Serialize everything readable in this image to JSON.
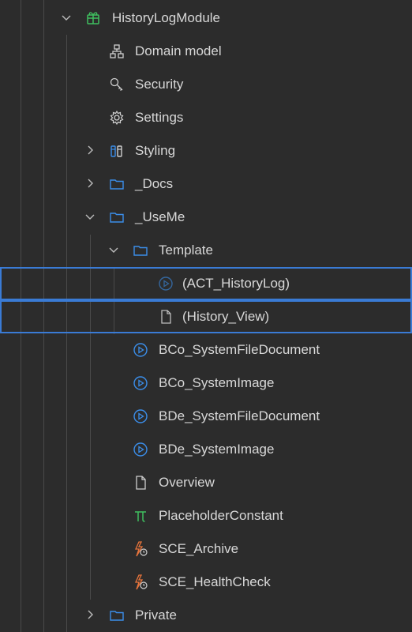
{
  "tree": {
    "items": [
      {
        "label": "HistoryLogModule",
        "icon": "module-icon"
      },
      {
        "label": "Domain model",
        "icon": "domain-model-icon"
      },
      {
        "label": "Security",
        "icon": "key-icon"
      },
      {
        "label": "Settings",
        "icon": "gear-icon"
      },
      {
        "label": "Styling",
        "icon": "styling-icon"
      },
      {
        "label": "_Docs",
        "icon": "folder-icon"
      },
      {
        "label": "_UseMe",
        "icon": "folder-icon"
      },
      {
        "label": "Template",
        "icon": "folder-icon"
      },
      {
        "label": "(ACT_HistoryLog)",
        "icon": "microflow-icon"
      },
      {
        "label": "(History_View)",
        "icon": "page-icon"
      },
      {
        "label": "BCo_SystemFileDocument",
        "icon": "microflow-icon"
      },
      {
        "label": "BCo_SystemImage",
        "icon": "microflow-icon"
      },
      {
        "label": "BDe_SystemFileDocument",
        "icon": "microflow-icon"
      },
      {
        "label": "BDe_SystemImage",
        "icon": "microflow-icon"
      },
      {
        "label": "Overview",
        "icon": "page-icon"
      },
      {
        "label": "PlaceholderConstant",
        "icon": "constant-pi-icon"
      },
      {
        "label": "SCE_Archive",
        "icon": "scheduled-event-icon"
      },
      {
        "label": "SCE_HealthCheck",
        "icon": "scheduled-event-icon"
      },
      {
        "label": "Private",
        "icon": "folder-icon"
      }
    ]
  },
  "colors": {
    "background": "#2c2c2c",
    "selection_border": "#3a7bd5",
    "module_green": "#3fbf5f",
    "microflow_blue": "#3b8eea",
    "scheduled_orange": "#e8743b"
  }
}
